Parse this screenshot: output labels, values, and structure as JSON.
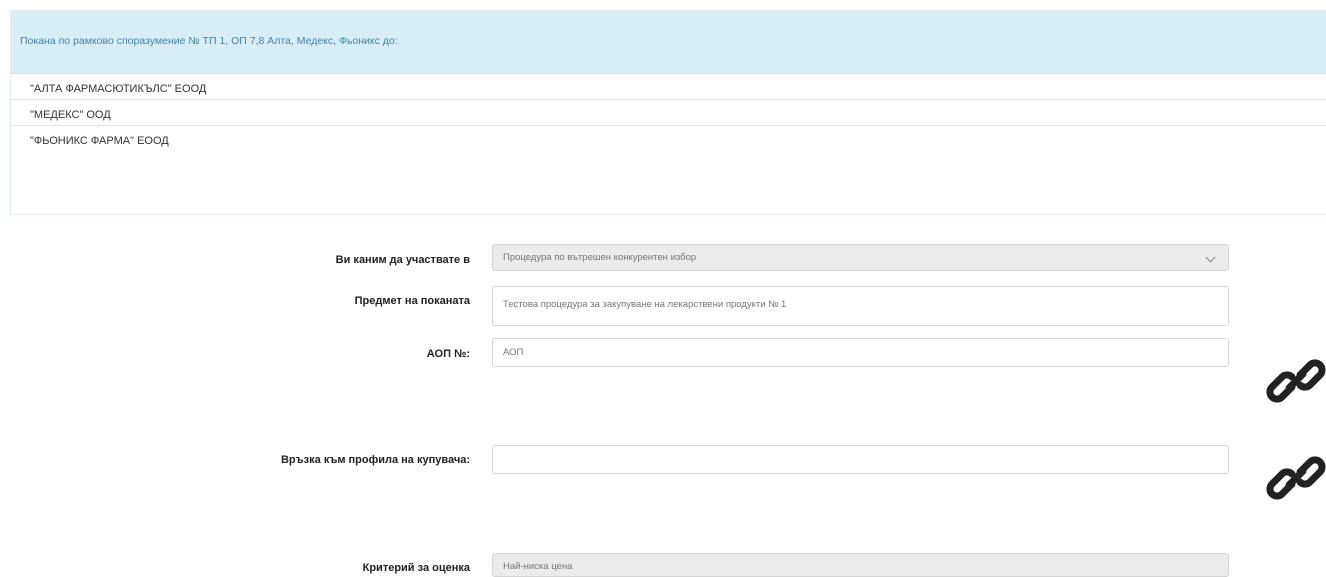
{
  "suppliers_panel": {
    "heading": "Покана по рамково споразумение № ТП 1, ОП 7,8 Алта, Медекс, Фьоникс до:",
    "suppliers": [
      "\"АЛТА ФАРМАСЮТИКЪЛС\" ЕООД",
      "\"МЕДЕКС\" ООД",
      "\"ФЬОНИКС ФАРМА\" ЕООД"
    ]
  },
  "form": {
    "procedure": {
      "label": "Ви каним да участвате в",
      "value": "Процедура по вътрешен конкурентен избор"
    },
    "subject": {
      "label": "Предмет на поканата",
      "value": "Тестова процедура за закупуване на лекарствени продукти № 1"
    },
    "aop": {
      "label": "АОП №:",
      "value": "АОП"
    },
    "buyer_profile": {
      "label": "Връзка към профила на купувача:",
      "value": ""
    },
    "criterion": {
      "label": "Критерий за оценка",
      "value": "Най-ниска цена"
    }
  },
  "icons": {
    "aop_link": "link-icon",
    "buyer_profile_link": "link-icon"
  }
}
